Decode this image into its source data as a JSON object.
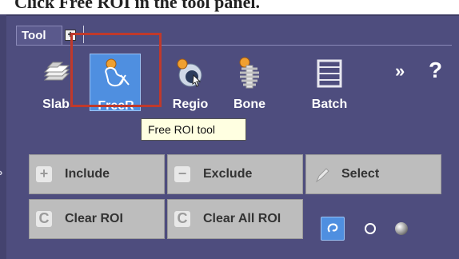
{
  "caption": "Click Free ROI in the tool panel.",
  "tab": {
    "label": "Tool",
    "plus": "+"
  },
  "tools": [
    {
      "label": "Slab"
    },
    {
      "label": "FreeR"
    },
    {
      "label": "Regio"
    },
    {
      "label": "Bone"
    },
    {
      "label": "Batch"
    }
  ],
  "more_label": "»",
  "help_label": "?",
  "tooltip": "Free ROI tool",
  "buttons": {
    "include": "Include",
    "exclude": "Exclude",
    "select": "Select",
    "clear_roi": "Clear ROI",
    "clear_all_roi": "Clear All ROI"
  },
  "colors": {
    "panel": "#4e4d7e",
    "active": "#4f8fe0",
    "highlight": "#c0392b",
    "button": "#bdbdbd"
  }
}
